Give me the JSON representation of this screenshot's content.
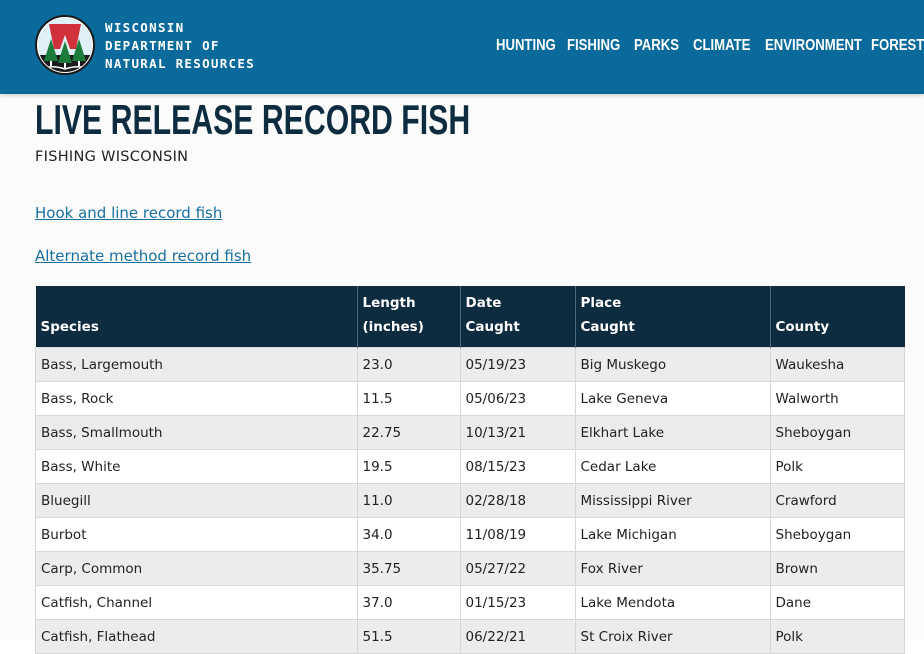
{
  "header": {
    "brand_lines": [
      "WISCONSIN",
      "DEPARTMENT OF",
      "NATURAL RESOURCES"
    ],
    "logo_letter": "W",
    "colors": {
      "bar": "#0a6a9b",
      "logo_red": "#d0313a",
      "logo_green": "#1c7a3a"
    },
    "nav": [
      "HUNTING",
      "FISHING",
      "PARKS",
      "CLIMATE",
      "ENVIRONMENT",
      "FORESTRY"
    ]
  },
  "page": {
    "title": "LIVE RELEASE RECORD FISH",
    "subtitle": "FISHING WISCONSIN",
    "links": [
      "Hook and line record fish",
      "Alternate method record fish"
    ]
  },
  "table": {
    "headers": [
      [
        "Species"
      ],
      [
        "Length",
        "(inches)"
      ],
      [
        "Date",
        "Caught"
      ],
      [
        "Place",
        "Caught"
      ],
      [
        "County"
      ]
    ],
    "rows": [
      [
        "Bass, Largemouth",
        "23.0",
        "05/19/23",
        "Big Muskego",
        "Waukesha"
      ],
      [
        "Bass, Rock",
        "11.5",
        "05/06/23",
        "Lake Geneva",
        "Walworth"
      ],
      [
        "Bass, Smallmouth",
        "22.75",
        "10/13/21",
        "Elkhart Lake",
        "Sheboygan"
      ],
      [
        "Bass, White",
        "19.5",
        "08/15/23",
        "Cedar Lake",
        "Polk"
      ],
      [
        "Bluegill",
        "11.0",
        "02/28/18",
        "Mississippi River",
        "Crawford"
      ],
      [
        "Burbot",
        "34.0",
        "11/08/19",
        "Lake Michigan",
        "Sheboygan"
      ],
      [
        "Carp, Common",
        "35.75",
        "05/27/22",
        "Fox River",
        "Brown"
      ],
      [
        "Catfish, Channel",
        "37.0",
        "01/15/23",
        "Lake Mendota",
        "Dane"
      ],
      [
        "Catfish, Flathead",
        "51.5",
        "06/22/21",
        "St Croix River",
        "Polk"
      ]
    ]
  }
}
